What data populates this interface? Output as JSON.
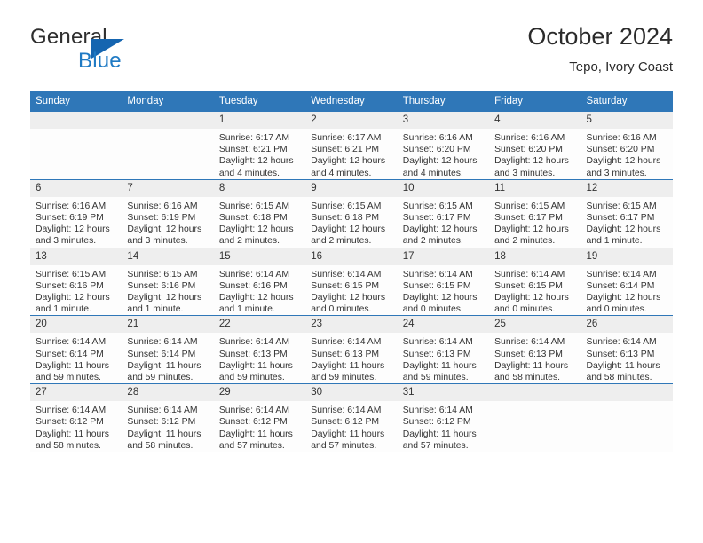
{
  "brand": {
    "name_top": "General",
    "name_bottom": "Blue",
    "flag_icon": "triangle-flag-icon",
    "accent_color": "#1565b0",
    "blue_text_color": "#1f7ac4"
  },
  "header": {
    "title": "October 2024",
    "subtitle": "Tepo, Ivory Coast"
  },
  "theme": {
    "header_blue": "#2f77b8",
    "daynum_band": "#eeeeee",
    "cell_bg": "#fdfdfd",
    "text": "#333333"
  },
  "weekdays": [
    "Sunday",
    "Monday",
    "Tuesday",
    "Wednesday",
    "Thursday",
    "Friday",
    "Saturday"
  ],
  "weeks": [
    [
      {
        "day": "",
        "sunrise": "",
        "sunset": "",
        "daylight_line1": "",
        "daylight_line2": ""
      },
      {
        "day": "",
        "sunrise": "",
        "sunset": "",
        "daylight_line1": "",
        "daylight_line2": ""
      },
      {
        "day": "1",
        "sunrise": "Sunrise: 6:17 AM",
        "sunset": "Sunset: 6:21 PM",
        "daylight_line1": "Daylight: 12 hours",
        "daylight_line2": "and 4 minutes."
      },
      {
        "day": "2",
        "sunrise": "Sunrise: 6:17 AM",
        "sunset": "Sunset: 6:21 PM",
        "daylight_line1": "Daylight: 12 hours",
        "daylight_line2": "and 4 minutes."
      },
      {
        "day": "3",
        "sunrise": "Sunrise: 6:16 AM",
        "sunset": "Sunset: 6:20 PM",
        "daylight_line1": "Daylight: 12 hours",
        "daylight_line2": "and 4 minutes."
      },
      {
        "day": "4",
        "sunrise": "Sunrise: 6:16 AM",
        "sunset": "Sunset: 6:20 PM",
        "daylight_line1": "Daylight: 12 hours",
        "daylight_line2": "and 3 minutes."
      },
      {
        "day": "5",
        "sunrise": "Sunrise: 6:16 AM",
        "sunset": "Sunset: 6:20 PM",
        "daylight_line1": "Daylight: 12 hours",
        "daylight_line2": "and 3 minutes."
      }
    ],
    [
      {
        "day": "6",
        "sunrise": "Sunrise: 6:16 AM",
        "sunset": "Sunset: 6:19 PM",
        "daylight_line1": "Daylight: 12 hours",
        "daylight_line2": "and 3 minutes."
      },
      {
        "day": "7",
        "sunrise": "Sunrise: 6:16 AM",
        "sunset": "Sunset: 6:19 PM",
        "daylight_line1": "Daylight: 12 hours",
        "daylight_line2": "and 3 minutes."
      },
      {
        "day": "8",
        "sunrise": "Sunrise: 6:15 AM",
        "sunset": "Sunset: 6:18 PM",
        "daylight_line1": "Daylight: 12 hours",
        "daylight_line2": "and 2 minutes."
      },
      {
        "day": "9",
        "sunrise": "Sunrise: 6:15 AM",
        "sunset": "Sunset: 6:18 PM",
        "daylight_line1": "Daylight: 12 hours",
        "daylight_line2": "and 2 minutes."
      },
      {
        "day": "10",
        "sunrise": "Sunrise: 6:15 AM",
        "sunset": "Sunset: 6:17 PM",
        "daylight_line1": "Daylight: 12 hours",
        "daylight_line2": "and 2 minutes."
      },
      {
        "day": "11",
        "sunrise": "Sunrise: 6:15 AM",
        "sunset": "Sunset: 6:17 PM",
        "daylight_line1": "Daylight: 12 hours",
        "daylight_line2": "and 2 minutes."
      },
      {
        "day": "12",
        "sunrise": "Sunrise: 6:15 AM",
        "sunset": "Sunset: 6:17 PM",
        "daylight_line1": "Daylight: 12 hours",
        "daylight_line2": "and 1 minute."
      }
    ],
    [
      {
        "day": "13",
        "sunrise": "Sunrise: 6:15 AM",
        "sunset": "Sunset: 6:16 PM",
        "daylight_line1": "Daylight: 12 hours",
        "daylight_line2": "and 1 minute."
      },
      {
        "day": "14",
        "sunrise": "Sunrise: 6:15 AM",
        "sunset": "Sunset: 6:16 PM",
        "daylight_line1": "Daylight: 12 hours",
        "daylight_line2": "and 1 minute."
      },
      {
        "day": "15",
        "sunrise": "Sunrise: 6:14 AM",
        "sunset": "Sunset: 6:16 PM",
        "daylight_line1": "Daylight: 12 hours",
        "daylight_line2": "and 1 minute."
      },
      {
        "day": "16",
        "sunrise": "Sunrise: 6:14 AM",
        "sunset": "Sunset: 6:15 PM",
        "daylight_line1": "Daylight: 12 hours",
        "daylight_line2": "and 0 minutes."
      },
      {
        "day": "17",
        "sunrise": "Sunrise: 6:14 AM",
        "sunset": "Sunset: 6:15 PM",
        "daylight_line1": "Daylight: 12 hours",
        "daylight_line2": "and 0 minutes."
      },
      {
        "day": "18",
        "sunrise": "Sunrise: 6:14 AM",
        "sunset": "Sunset: 6:15 PM",
        "daylight_line1": "Daylight: 12 hours",
        "daylight_line2": "and 0 minutes."
      },
      {
        "day": "19",
        "sunrise": "Sunrise: 6:14 AM",
        "sunset": "Sunset: 6:14 PM",
        "daylight_line1": "Daylight: 12 hours",
        "daylight_line2": "and 0 minutes."
      }
    ],
    [
      {
        "day": "20",
        "sunrise": "Sunrise: 6:14 AM",
        "sunset": "Sunset: 6:14 PM",
        "daylight_line1": "Daylight: 11 hours",
        "daylight_line2": "and 59 minutes."
      },
      {
        "day": "21",
        "sunrise": "Sunrise: 6:14 AM",
        "sunset": "Sunset: 6:14 PM",
        "daylight_line1": "Daylight: 11 hours",
        "daylight_line2": "and 59 minutes."
      },
      {
        "day": "22",
        "sunrise": "Sunrise: 6:14 AM",
        "sunset": "Sunset: 6:13 PM",
        "daylight_line1": "Daylight: 11 hours",
        "daylight_line2": "and 59 minutes."
      },
      {
        "day": "23",
        "sunrise": "Sunrise: 6:14 AM",
        "sunset": "Sunset: 6:13 PM",
        "daylight_line1": "Daylight: 11 hours",
        "daylight_line2": "and 59 minutes."
      },
      {
        "day": "24",
        "sunrise": "Sunrise: 6:14 AM",
        "sunset": "Sunset: 6:13 PM",
        "daylight_line1": "Daylight: 11 hours",
        "daylight_line2": "and 59 minutes."
      },
      {
        "day": "25",
        "sunrise": "Sunrise: 6:14 AM",
        "sunset": "Sunset: 6:13 PM",
        "daylight_line1": "Daylight: 11 hours",
        "daylight_line2": "and 58 minutes."
      },
      {
        "day": "26",
        "sunrise": "Sunrise: 6:14 AM",
        "sunset": "Sunset: 6:13 PM",
        "daylight_line1": "Daylight: 11 hours",
        "daylight_line2": "and 58 minutes."
      }
    ],
    [
      {
        "day": "27",
        "sunrise": "Sunrise: 6:14 AM",
        "sunset": "Sunset: 6:12 PM",
        "daylight_line1": "Daylight: 11 hours",
        "daylight_line2": "and 58 minutes."
      },
      {
        "day": "28",
        "sunrise": "Sunrise: 6:14 AM",
        "sunset": "Sunset: 6:12 PM",
        "daylight_line1": "Daylight: 11 hours",
        "daylight_line2": "and 58 minutes."
      },
      {
        "day": "29",
        "sunrise": "Sunrise: 6:14 AM",
        "sunset": "Sunset: 6:12 PM",
        "daylight_line1": "Daylight: 11 hours",
        "daylight_line2": "and 57 minutes."
      },
      {
        "day": "30",
        "sunrise": "Sunrise: 6:14 AM",
        "sunset": "Sunset: 6:12 PM",
        "daylight_line1": "Daylight: 11 hours",
        "daylight_line2": "and 57 minutes."
      },
      {
        "day": "31",
        "sunrise": "Sunrise: 6:14 AM",
        "sunset": "Sunset: 6:12 PM",
        "daylight_line1": "Daylight: 11 hours",
        "daylight_line2": "and 57 minutes."
      },
      {
        "day": "",
        "sunrise": "",
        "sunset": "",
        "daylight_line1": "",
        "daylight_line2": ""
      },
      {
        "day": "",
        "sunrise": "",
        "sunset": "",
        "daylight_line1": "",
        "daylight_line2": ""
      }
    ]
  ]
}
